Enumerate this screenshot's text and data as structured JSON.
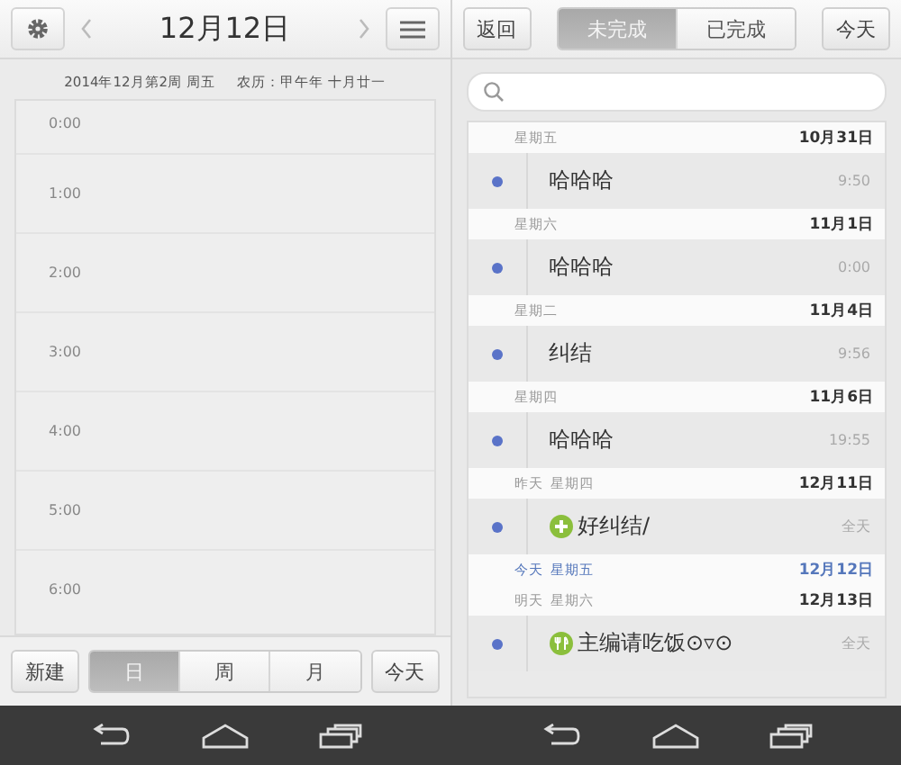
{
  "day_view": {
    "header": {
      "title": "12月12日"
    },
    "week_info": "2014年12月第2周 周五",
    "lunar": "农历：甲午年 十月廿一",
    "hours": [
      "0:00",
      "1:00",
      "2:00",
      "3:00",
      "4:00",
      "5:00",
      "6:00"
    ],
    "new_button": "新建",
    "view_tabs": [
      {
        "label": "日",
        "selected": true
      },
      {
        "label": "周",
        "selected": false
      },
      {
        "label": "月",
        "selected": false
      }
    ],
    "today_button": "今天"
  },
  "task_list": {
    "back_button": "返回",
    "tabs": [
      {
        "label": "未完成",
        "selected": true
      },
      {
        "label": "已完成",
        "selected": false
      }
    ],
    "today_button": "今天",
    "groups": [
      {
        "weekday": "星期五",
        "date": "10月31日",
        "today": false,
        "items": [
          {
            "title": "哈哈哈",
            "time": "9:50",
            "kind": "plain"
          }
        ]
      },
      {
        "weekday": "星期六",
        "date": "11月1日",
        "today": false,
        "items": [
          {
            "title": "哈哈哈",
            "time": "0:00",
            "kind": "plain"
          }
        ]
      },
      {
        "weekday": "星期二",
        "date": "11月4日",
        "today": false,
        "items": [
          {
            "title": "纠结",
            "time": "9:56",
            "kind": "plain"
          }
        ]
      },
      {
        "weekday": "星期四",
        "date": "11月6日",
        "today": false,
        "items": [
          {
            "title": "哈哈哈",
            "time": "19:55",
            "kind": "plain"
          }
        ]
      },
      {
        "relative": "昨天",
        "weekday": "星期四",
        "date": "12月11日",
        "today": false,
        "items": [
          {
            "title": "好纠结/",
            "time": "全天",
            "kind": "plus"
          }
        ]
      },
      {
        "relative": "今天",
        "weekday": "星期五",
        "date": "12月12日",
        "today": true
      },
      {
        "relative": "明天",
        "weekday": "星期六",
        "date": "12月13日",
        "today": false,
        "items": [
          {
            "title": "主编请吃饭⊙▿⊙",
            "time": "全天",
            "kind": "meal"
          }
        ]
      }
    ]
  }
}
